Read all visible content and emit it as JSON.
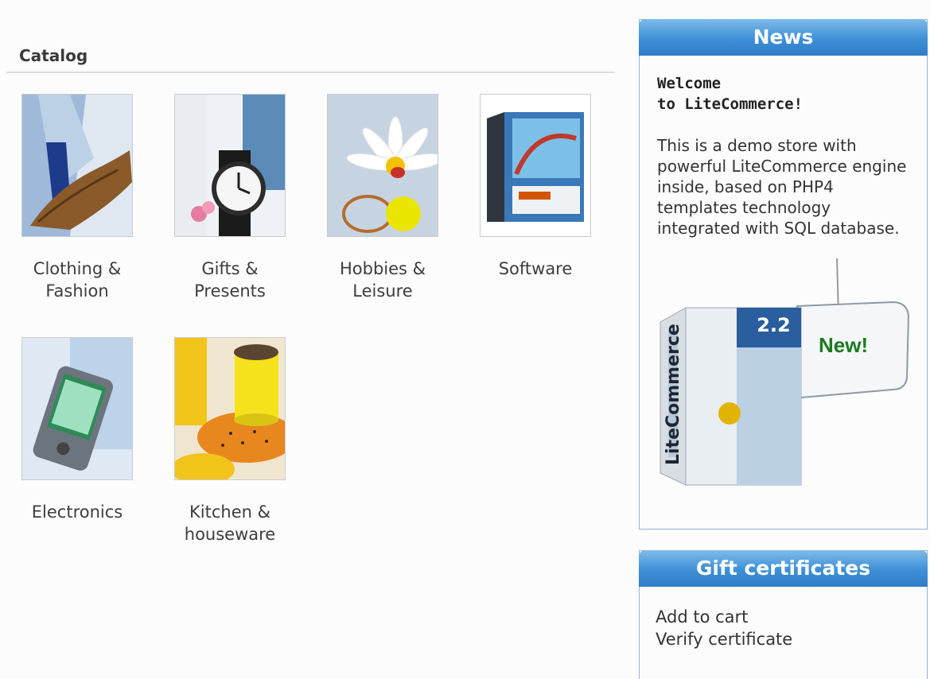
{
  "catalog": {
    "title": "Catalog",
    "categories": [
      {
        "label": "Clothing &\nFashion",
        "icon": "clothing-image"
      },
      {
        "label": "Gifts &\nPresents",
        "icon": "watch-image"
      },
      {
        "label": "Hobbies &\nLeisure",
        "icon": "daisy-tennis-image"
      },
      {
        "label": "Software",
        "icon": "software-box-image"
      },
      {
        "label": "Electronics",
        "icon": "pda-image"
      },
      {
        "label": "Kitchen &\nhouseware",
        "icon": "cup-saucer-image"
      }
    ]
  },
  "news": {
    "title": "News",
    "welcome": "Welcome\nto LiteCommerce!",
    "body": "This is a demo store with powerful LiteCommerce engine inside, based on PHP4 templates technology integrated with SQL database.",
    "promo": {
      "version": "2.2",
      "product": "LiteCommerce",
      "tag": "New!"
    }
  },
  "gift": {
    "title": "Gift certificates",
    "links": [
      "Add to cart",
      "Verify certificate"
    ]
  },
  "colors": {
    "accent": "#3d8fd6",
    "border": "#8fb5d8",
    "new_tag": "#1d7a1d"
  }
}
